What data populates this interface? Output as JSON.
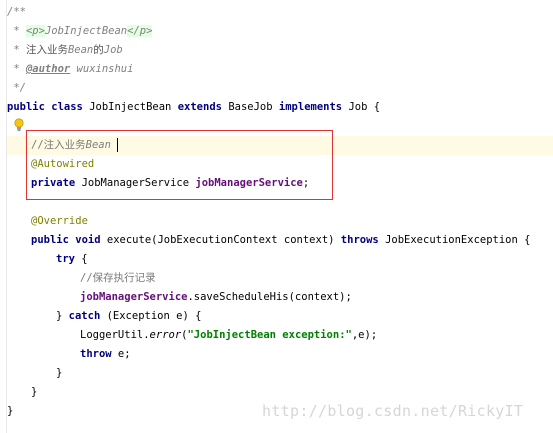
{
  "javadoc": {
    "open": "/**",
    "line1_prefix": " * ",
    "p_open": "<p>",
    "p_class": "JobInjectBean",
    "p_close": "</p>",
    "line2_prefix": " * ",
    "line2_cn1": "注入业务",
    "line2_bean": "Bean",
    "line2_cn2": "的",
    "line2_job": "Job",
    "line3_prefix": " * ",
    "author_tag": "@author",
    "author_name": " wuxinshui",
    "close": " */"
  },
  "class_decl": {
    "kw_public": "public",
    "kw_class": "class",
    "name": "JobInjectBean",
    "kw_extends": "extends",
    "base": "BaseJob",
    "kw_implements": "implements",
    "iface": "Job",
    "brace": " {"
  },
  "field": {
    "comment_cn": "//注入业务",
    "comment_bean": "Bean",
    "annotation": "@Autowired",
    "kw_private": "private",
    "type": "JobManagerService",
    "name": "jobManagerService",
    "semi": ";"
  },
  "method": {
    "override": "@Override",
    "kw_public": "public",
    "kw_void": "void",
    "sig": "execute(JobExecutionContext context)",
    "kw_throws": "throws",
    "exc": "JobExecutionException {",
    "kw_try": "try",
    "try_brace": " {",
    "comment": "//保存执行记录",
    "call_field": "jobManagerService",
    "call_rest": ".saveScheduleHis(context);",
    "catch_pre": "} ",
    "kw_catch": "catch",
    "catch_rest": " (Exception e) {",
    "logger": "LoggerUtil.",
    "logger_method": "error",
    "logger_open": "(",
    "logger_str": "\"JobInjectBean exception:\"",
    "logger_rest": ",e);",
    "kw_throw": "throw",
    "throw_rest": " e;",
    "close_inner": "}",
    "close_method": "}",
    "close_class": "}"
  },
  "watermark": "http://blog.csdn.net/RickyIT",
  "colors": {
    "keyword": "#000080",
    "annotation": "#808000",
    "field": "#660e7a",
    "string": "#008000",
    "comment": "#808080",
    "highlight_box": "#e23333",
    "current_line": "#fffae3"
  }
}
